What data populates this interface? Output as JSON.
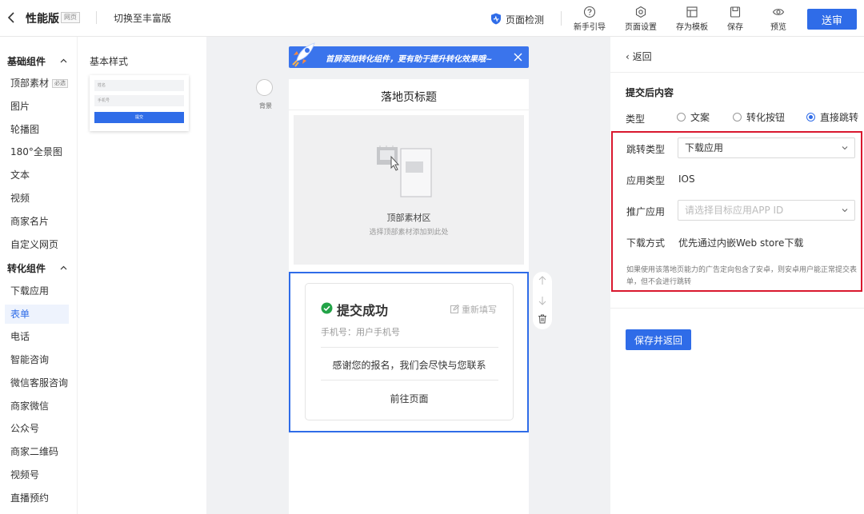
{
  "header": {
    "title": "性能版",
    "page_tag": "网页",
    "switch_label": "切换至丰富版",
    "check_label": "页面检测",
    "tools": [
      {
        "label": "新手引导",
        "icon": "help-circle-icon"
      },
      {
        "label": "页面设置",
        "icon": "settings-hexagon-icon"
      },
      {
        "label": "存为模板",
        "icon": "template-icon"
      },
      {
        "label": "保存",
        "icon": "save-icon"
      },
      {
        "label": "预览",
        "icon": "eye-icon"
      }
    ],
    "submit_label": "送审"
  },
  "sidebar": {
    "groups": [
      {
        "label": "基础组件",
        "items": [
          {
            "label": "顶部素材",
            "badge": "必选"
          },
          {
            "label": "图片"
          },
          {
            "label": "轮播图"
          },
          {
            "label": "180°全景图"
          },
          {
            "label": "文本"
          },
          {
            "label": "视频"
          },
          {
            "label": "商家名片"
          },
          {
            "label": "自定义网页"
          }
        ]
      },
      {
        "label": "转化组件",
        "items": [
          {
            "label": "下载应用"
          },
          {
            "label": "表单",
            "active": true
          },
          {
            "label": "电话"
          },
          {
            "label": "智能咨询"
          },
          {
            "label": "微信客服咨询"
          },
          {
            "label": "商家微信"
          },
          {
            "label": "公众号"
          },
          {
            "label": "商家二维码"
          },
          {
            "label": "视频号"
          },
          {
            "label": "直播预约"
          }
        ]
      }
    ]
  },
  "style_panel": {
    "title": "基本样式",
    "thumb_fields": [
      "姓名",
      "手机号"
    ],
    "thumb_button": "提交"
  },
  "canvas": {
    "background_label": "背景",
    "banner_text": "首屏添加转化组件，更有助于提升转化效果哦~",
    "page_title": "落地页标题",
    "hero_label": "顶部素材区",
    "hero_sub": "选择顶部素材添加到此处",
    "success_title": "提交成功",
    "refill_label": "重新填写",
    "phone_line": "手机号：用户手机号",
    "thanks_text": "感谢您的报名，我们会尽快与您联系",
    "goto_label": "前往页面"
  },
  "right_panel": {
    "back_label": "返回",
    "section_title": "提交后内容",
    "type_label": "类型",
    "type_options": [
      {
        "label": "文案",
        "checked": false
      },
      {
        "label": "转化按钮",
        "checked": false
      },
      {
        "label": "直接跳转",
        "checked": true
      }
    ],
    "jump_type_label": "跳转类型",
    "jump_type_value": "下载应用",
    "app_type_label": "应用类型",
    "app_type_value": "IOS",
    "promo_app_label": "推广应用",
    "promo_app_placeholder": "请选择目标应用APP ID",
    "download_method_label": "下载方式",
    "download_method_value": "优先通过内嵌Web store下载",
    "note": "如果使用该落地页能力的广告定向包含了安卓，则安卓用户能正常提交表单，但不会进行跳转",
    "save_back_label": "保存并返回"
  },
  "colors": {
    "accent": "#2f6ce8",
    "highlight_border": "#d9182e"
  }
}
